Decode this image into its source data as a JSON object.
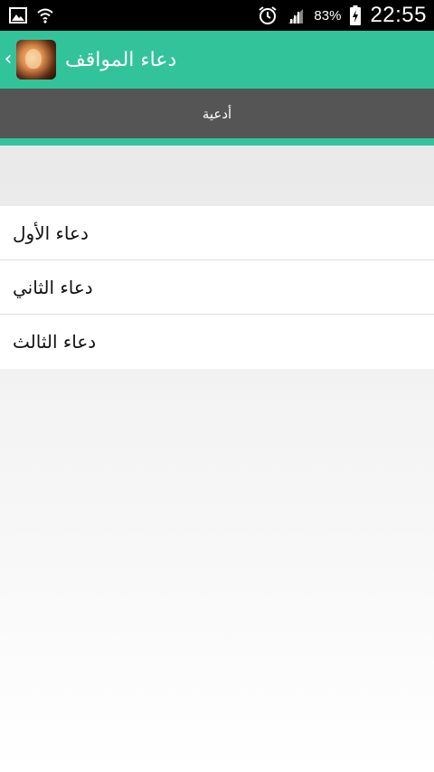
{
  "status_bar": {
    "battery_percent": "83%",
    "time": "22:55",
    "icons": [
      "gallery-icon",
      "wifi-icon",
      "alarm-icon",
      "signal-icon",
      "battery-charging-icon"
    ]
  },
  "action_bar": {
    "title": "دعاء المواقف",
    "back_icon": "chevron-left-icon"
  },
  "tabs": [
    {
      "label": "أدعية",
      "selected": true
    }
  ],
  "list": {
    "items": [
      {
        "label": "دعاء الأول"
      },
      {
        "label": "دعاء الثاني"
      },
      {
        "label": "دعاء الثالث"
      }
    ]
  },
  "colors": {
    "accent": "#33c39b",
    "tab_bar": "#555555",
    "status_bar": "#000000"
  }
}
